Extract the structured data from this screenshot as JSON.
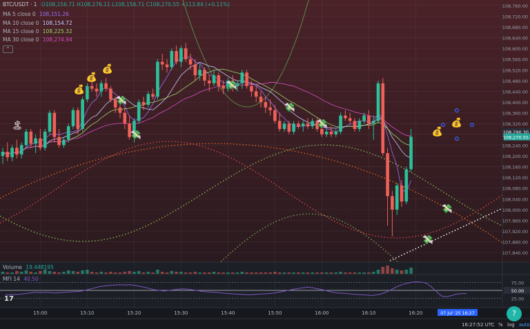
{
  "header": {
    "symbol": "BTC/USDT · 1",
    "ohlc": "O108,156.71 H108,276.11 L108,156.71 C108,270.55 +113.84 (+0.11%)"
  },
  "indicators": [
    {
      "label": "MA 5 close 0",
      "value": "108,151.26",
      "color": "#9c6ef5"
    },
    {
      "label": "MA 10 close 0",
      "value": "108,154.72",
      "color": "#c9ccff"
    },
    {
      "label": "MA 15 close 0",
      "value": "108,225.32",
      "color": "#9fd36b"
    },
    {
      "label": "MA 30 close 0",
      "value": "108,274.94",
      "color": "#d84fc6"
    }
  ],
  "volume": {
    "label": "Volume",
    "value": "19.448195",
    "color": "#26a69a"
  },
  "mfi": {
    "label": "MFI 14",
    "value": "40.50",
    "color": "#7e57c2",
    "ticks": [
      "75.00",
      "50.00",
      "25.00"
    ],
    "values": [
      36,
      36,
      37,
      38,
      40,
      42,
      44,
      43,
      44,
      43,
      42,
      43,
      44,
      45,
      46,
      47,
      50,
      54,
      58,
      62,
      64,
      66,
      67,
      68,
      67,
      68,
      66,
      63,
      60,
      56,
      52,
      50,
      48,
      50,
      52,
      54,
      55,
      53,
      51,
      49,
      46,
      45,
      44,
      43,
      41,
      40,
      39,
      38,
      37,
      36,
      37,
      38,
      39,
      40,
      41,
      44,
      47,
      50,
      53,
      56,
      58,
      60,
      58,
      55,
      52,
      48,
      44,
      42,
      41,
      40,
      38,
      37,
      36,
      35,
      34,
      36,
      40,
      46,
      54,
      62,
      68,
      72,
      76,
      77,
      76,
      72,
      60,
      45,
      32,
      30,
      34,
      38,
      40,
      40
    ]
  },
  "colors": {
    "up": "#2dc09a",
    "down": "#f0615a",
    "bg_top": "#4a2228",
    "bg_bottom": "#2a1a1f",
    "pane": "#1d1f26"
  },
  "chart_data": {
    "type": "candlestick",
    "symbol": "BTC/USDT",
    "interval": "1",
    "ylim": [
      107820,
      108780
    ],
    "y_ticks": [
      "108,760.00",
      "108,720.00",
      "108,680.00",
      "108,640.00",
      "108,600.00",
      "108,560.00",
      "108,520.00",
      "108,480.00",
      "108,440.00",
      "108,400.00",
      "108,360.00",
      "108,320.00",
      "108,280.00",
      "108,240.00",
      "108,200.00",
      "108,160.00",
      "108,120.00",
      "108,080.00",
      "108,040.00",
      "108,000.00",
      "107,960.00",
      "107,920.00",
      "107,880.00",
      "107,840.00"
    ],
    "x_ticks": [
      "15:00",
      "15:10",
      "15:20",
      "15:30",
      "15:40",
      "15:50",
      "16:00",
      "16:10",
      "16:20"
    ],
    "x_tick_index": [
      8,
      18,
      28,
      38,
      48,
      58,
      68,
      78,
      88
    ],
    "current_time_label": "07 Jul '25   16:27",
    "price_labels": [
      {
        "text": "108,290.30",
        "value": 108290.3,
        "color": "#2a2e39"
      },
      {
        "text": "108,270.55",
        "value": 108270.55,
        "color": "#26a69a"
      }
    ],
    "candles": [
      [
        108200,
        108230,
        108170,
        108215
      ],
      [
        108215,
        108250,
        108180,
        108195
      ],
      [
        108195,
        108240,
        108180,
        108230
      ],
      [
        108230,
        108260,
        108190,
        108205
      ],
      [
        108205,
        108250,
        108190,
        108240
      ],
      [
        108240,
        108300,
        108230,
        108290
      ],
      [
        108290,
        108300,
        108230,
        108245
      ],
      [
        108245,
        108280,
        108210,
        108265
      ],
      [
        108265,
        108300,
        108220,
        108230
      ],
      [
        108230,
        108300,
        108220,
        108290
      ],
      [
        108290,
        108370,
        108280,
        108360
      ],
      [
        108360,
        108370,
        108250,
        108270
      ],
      [
        108270,
        108300,
        108230,
        108240
      ],
      [
        108240,
        108270,
        108230,
        108260
      ],
      [
        108260,
        108320,
        108250,
        108310
      ],
      [
        108310,
        108380,
        108300,
        108370
      ],
      [
        108370,
        108380,
        108280,
        108300
      ],
      [
        108300,
        108420,
        108290,
        108410
      ],
      [
        108410,
        108470,
        108400,
        108460
      ],
      [
        108460,
        108480,
        108440,
        108450
      ],
      [
        108450,
        108470,
        108420,
        108440
      ],
      [
        108440,
        108480,
        108420,
        108470
      ],
      [
        108470,
        108490,
        108440,
        108450
      ],
      [
        108450,
        108460,
        108400,
        108410
      ],
      [
        108410,
        108420,
        108360,
        108380
      ],
      [
        108380,
        108400,
        108340,
        108360
      ],
      [
        108360,
        108380,
        108300,
        108320
      ],
      [
        108320,
        108350,
        108260,
        108270
      ],
      [
        108270,
        108340,
        108250,
        108330
      ],
      [
        108330,
        108410,
        108320,
        108400
      ],
      [
        108400,
        108420,
        108370,
        108390
      ],
      [
        108390,
        108440,
        108380,
        108430
      ],
      [
        108430,
        108450,
        108410,
        108420
      ],
      [
        108420,
        108560,
        108410,
        108550
      ],
      [
        108550,
        108580,
        108520,
        108540
      ],
      [
        108540,
        108560,
        108510,
        108530
      ],
      [
        108530,
        108600,
        108520,
        108590
      ],
      [
        108590,
        108610,
        108540,
        108550
      ],
      [
        108550,
        108610,
        108530,
        108600
      ],
      [
        108600,
        108620,
        108550,
        108560
      ],
      [
        108560,
        108580,
        108520,
        108540
      ],
      [
        108540,
        108560,
        108480,
        108500
      ],
      [
        108500,
        108540,
        108480,
        108520
      ],
      [
        108520,
        108530,
        108460,
        108480
      ],
      [
        108480,
        108500,
        108440,
        108470
      ],
      [
        108470,
        108520,
        108460,
        108500
      ],
      [
        108500,
        108510,
        108440,
        108460
      ],
      [
        108460,
        108480,
        108430,
        108450
      ],
      [
        108450,
        108490,
        108440,
        108480
      ],
      [
        108480,
        108500,
        108440,
        108460
      ],
      [
        108460,
        108480,
        108440,
        108470
      ],
      [
        108470,
        108520,
        108450,
        108510
      ],
      [
        108510,
        108520,
        108450,
        108460
      ],
      [
        108460,
        108480,
        108420,
        108440
      ],
      [
        108440,
        108460,
        108400,
        108420
      ],
      [
        108420,
        108440,
        108380,
        108400
      ],
      [
        108400,
        108420,
        108360,
        108380
      ],
      [
        108380,
        108410,
        108350,
        108370
      ],
      [
        108370,
        108390,
        108320,
        108330
      ],
      [
        108330,
        108360,
        108290,
        108300
      ],
      [
        108300,
        108330,
        108290,
        108320
      ],
      [
        108320,
        108330,
        108280,
        108290
      ],
      [
        108290,
        108330,
        108280,
        108320
      ],
      [
        108320,
        108330,
        108300,
        108310
      ],
      [
        108310,
        108330,
        108290,
        108320
      ],
      [
        108320,
        108340,
        108300,
        108310
      ],
      [
        108310,
        108340,
        108300,
        108330
      ],
      [
        108330,
        108340,
        108290,
        108300
      ],
      [
        108300,
        108320,
        108270,
        108280
      ],
      [
        108280,
        108300,
        108270,
        108290
      ],
      [
        108290,
        108310,
        108270,
        108280
      ],
      [
        108280,
        108300,
        108270,
        108290
      ],
      [
        108290,
        108360,
        108280,
        108350
      ],
      [
        108350,
        108370,
        108330,
        108340
      ],
      [
        108340,
        108360,
        108320,
        108330
      ],
      [
        108330,
        108340,
        108290,
        108300
      ],
      [
        108300,
        108340,
        108290,
        108330
      ],
      [
        108330,
        108360,
        108320,
        108350
      ],
      [
        108350,
        108370,
        108300,
        108320
      ],
      [
        108320,
        108350,
        108260,
        108330
      ],
      [
        108330,
        108480,
        108320,
        108470
      ],
      [
        108470,
        108490,
        108200,
        108210
      ],
      [
        108210,
        108230,
        107940,
        108050
      ],
      [
        108050,
        108070,
        107900,
        108000
      ],
      [
        108000,
        108100,
        107980,
        108090
      ],
      [
        108090,
        108110,
        108010,
        108030
      ],
      [
        108030,
        108160,
        108020,
        108150
      ],
      [
        108150,
        108300,
        108140,
        108271
      ]
    ]
  }
}
